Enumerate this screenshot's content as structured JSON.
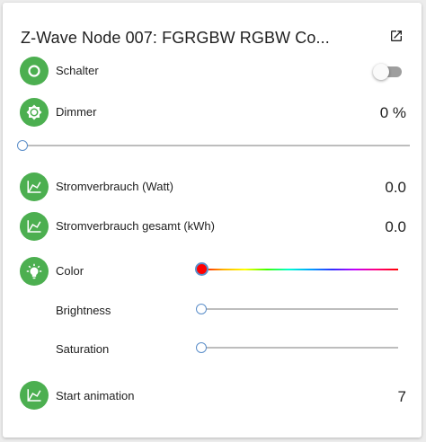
{
  "card": {
    "title": "Z-Wave Node 007: FGRGBW RGBW Co...",
    "open_icon": "open-in-new-icon"
  },
  "entities": {
    "schalter": {
      "label": "Schalter",
      "icon": "circle-outline-icon",
      "state": "off"
    },
    "dimmer": {
      "label": "Dimmer",
      "icon": "brightness-icon",
      "value": "0 %",
      "level_percent": 0
    },
    "power": {
      "label": "Stromverbrauch (Watt)",
      "icon": "chart-line-icon",
      "value": "0.0"
    },
    "power_total": {
      "label": "Stromverbrauch gesamt (kWh)",
      "icon": "chart-line-icon",
      "value": "0.0"
    },
    "color": {
      "label": "Color",
      "icon": "lightbulb-icon",
      "hue_value": 0,
      "selected_color": "#ff0000"
    },
    "brightness": {
      "label": "Brightness",
      "level_percent": 0
    },
    "saturation": {
      "label": "Saturation",
      "level_percent": 0
    },
    "animation": {
      "label": "Start animation",
      "icon": "chart-line-icon",
      "value": "7"
    }
  },
  "colors": {
    "badge": "#4caf50",
    "slider_knob_border": "#5b8ec9",
    "track": "#bdbdbd"
  }
}
